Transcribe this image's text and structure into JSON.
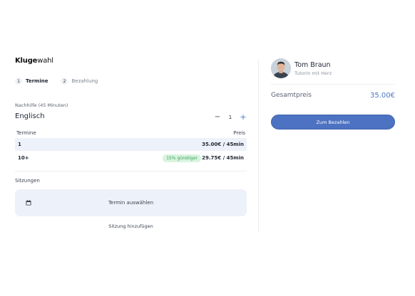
{
  "brand": {
    "bold": "Kluge",
    "light": "wahl"
  },
  "steps": [
    {
      "number": "1",
      "label": "Termine",
      "active": true
    },
    {
      "number": "2",
      "label": "Bezahlung",
      "active": false
    }
  ],
  "subject": {
    "caption": "Nachhilfe (45 Minuten)",
    "name": "Englisch",
    "quantity": "1",
    "minus_symbol": "−",
    "plus_symbol": "+"
  },
  "pricing_table": {
    "headers": {
      "left": "Termine",
      "right": "Preis"
    },
    "rows": [
      {
        "qty": "1",
        "price": "35.00€ / 45min",
        "badge": "",
        "selected": true
      },
      {
        "qty": "10+",
        "price": "29.75€ / 45min",
        "badge": "15% günstiger",
        "selected": false
      }
    ]
  },
  "sessions": {
    "label": "Sitzungen",
    "select_text": "Termin auswählen",
    "add_link": "Sitzung hinzufügen",
    "icon": "calendar-icon"
  },
  "tutor": {
    "name": "Tom Braun",
    "subtitle": "TutorIn mit Herz"
  },
  "summary": {
    "total_label": "Gesamtpreis",
    "total_value": "35.00€",
    "pay_button": "Zum Bezahlen"
  },
  "colors": {
    "accent": "#4d72c2",
    "price_text": "#4d78c5",
    "row_highlight": "#edf1f9",
    "badge_bg": "#d9f3df",
    "badge_text": "#3aa25a"
  }
}
